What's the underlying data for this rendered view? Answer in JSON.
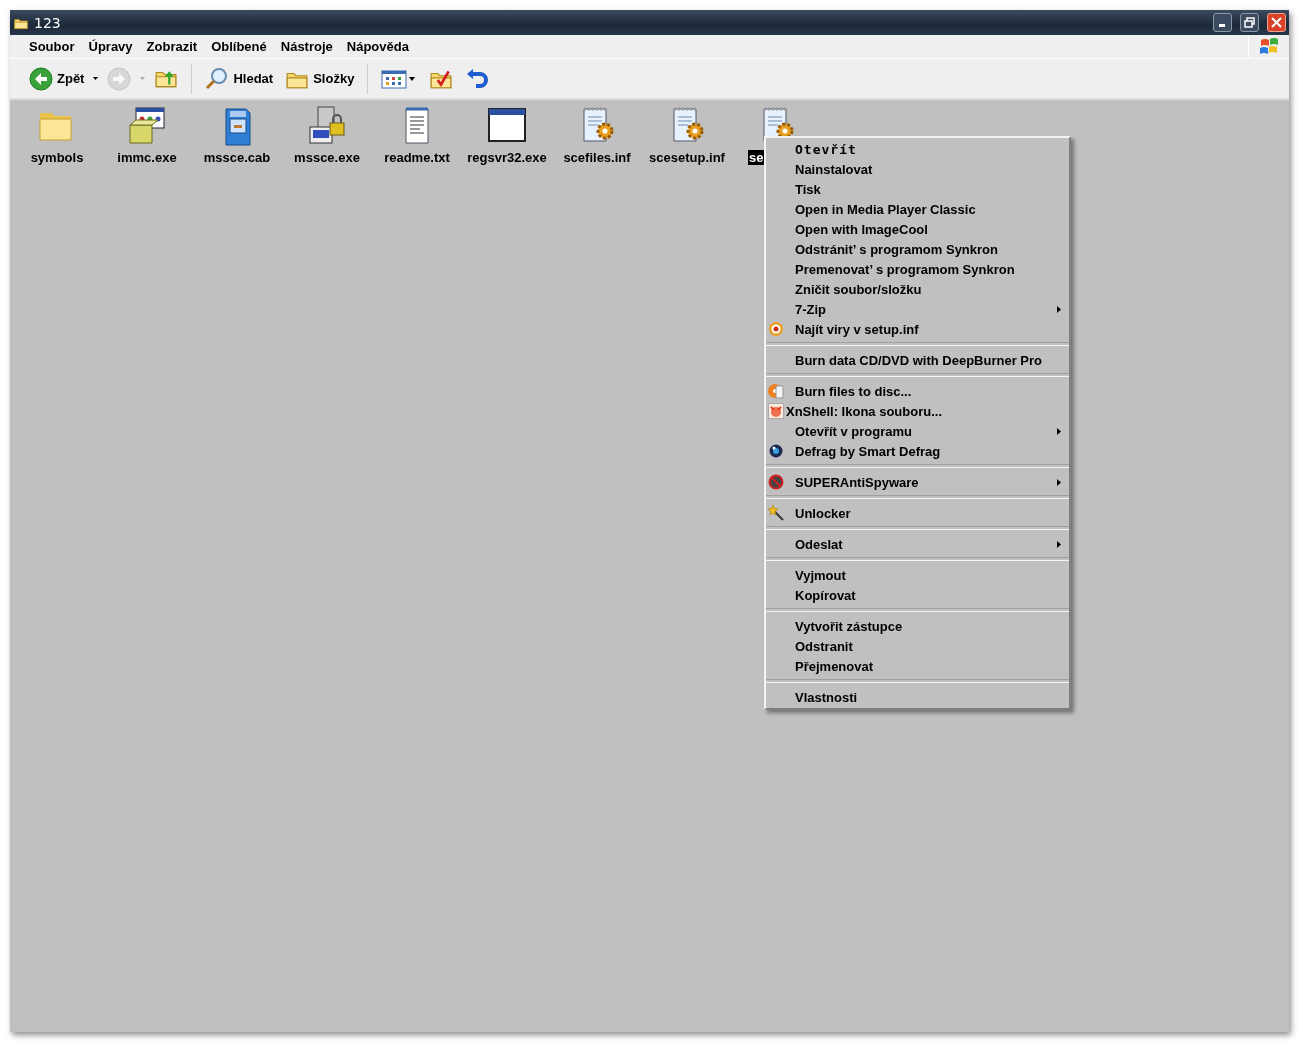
{
  "window": {
    "title": "123"
  },
  "menu_bar": [
    {
      "label": "Soubor"
    },
    {
      "label": "Úpravy"
    },
    {
      "label": "Zobrazit"
    },
    {
      "label": "Oblíbené"
    },
    {
      "label": "Nástroje"
    },
    {
      "label": "Nápověda"
    }
  ],
  "toolbar": [
    {
      "kind": "back",
      "label": "Zpět",
      "disabled": false
    },
    {
      "kind": "forward",
      "disabled": true
    },
    {
      "kind": "up",
      "disabled": false
    },
    {
      "kind": "search",
      "label": "Hledat",
      "disabled": false
    },
    {
      "kind": "folders",
      "label": "Složky",
      "disabled": false
    },
    {
      "kind": "views",
      "disabled": false
    },
    {
      "kind": "folder-check",
      "disabled": false
    },
    {
      "kind": "undo",
      "disabled": false
    }
  ],
  "files": [
    {
      "name": "symbols",
      "kind": "folder",
      "selected": false
    },
    {
      "name": "immc.exe",
      "kind": "installer",
      "selected": false
    },
    {
      "name": "mssce.cab",
      "kind": "cabinet",
      "selected": false
    },
    {
      "name": "mssce.exe",
      "kind": "server",
      "selected": false
    },
    {
      "name": "readme.txt",
      "kind": "text",
      "selected": false
    },
    {
      "name": "regsvr32.exe",
      "kind": "app",
      "selected": false
    },
    {
      "name": "scefiles.inf",
      "kind": "settings",
      "selected": false
    },
    {
      "name": "scesetup.inf",
      "kind": "settings",
      "selected": false
    },
    {
      "name": "se",
      "kind": "settings",
      "selected": true
    }
  ],
  "context_menu": [
    {
      "kind": "item",
      "label": "Otevřít",
      "default": true,
      "submenu": false
    },
    {
      "kind": "item",
      "label": "Nainstalovat",
      "default": false,
      "submenu": false
    },
    {
      "kind": "item",
      "label": "Tisk",
      "default": false,
      "submenu": false
    },
    {
      "kind": "item",
      "label": "Open in Media Player Classic",
      "default": false,
      "submenu": false
    },
    {
      "kind": "item",
      "label": "Open with ImageCool",
      "default": false,
      "submenu": false
    },
    {
      "kind": "item",
      "label": "Odstránit’ s programom Synkron",
      "default": false,
      "submenu": false
    },
    {
      "kind": "item",
      "label": "Premenovat’ s programom Synkron",
      "default": false,
      "submenu": false
    },
    {
      "kind": "item",
      "label": "Zničit soubor/složku",
      "default": false,
      "submenu": false
    },
    {
      "kind": "item",
      "label": "7-Zip",
      "default": false,
      "submenu": true
    },
    {
      "kind": "item",
      "label": "Najít viry v setup.inf",
      "default": false,
      "submenu": false
    },
    {
      "kind": "separator"
    },
    {
      "kind": "item",
      "label": "Burn data CD/DVD with DeepBurner Pro",
      "default": false,
      "submenu": false
    },
    {
      "kind": "separator"
    },
    {
      "kind": "item",
      "label": "Burn files to disc...",
      "default": false,
      "submenu": false
    },
    {
      "kind": "item",
      "label": "XnShell: Ikona souboru...",
      "default": false,
      "submenu": false
    },
    {
      "kind": "item",
      "label": "Otevřít v programu",
      "default": false,
      "submenu": true
    },
    {
      "kind": "item",
      "label": "Defrag by Smart Defrag",
      "default": false,
      "submenu": false
    },
    {
      "kind": "separator"
    },
    {
      "kind": "item",
      "label": "SUPERAntiSpyware",
      "default": false,
      "submenu": true
    },
    {
      "kind": "separator"
    },
    {
      "kind": "item",
      "label": "Unlocker",
      "default": false,
      "submenu": false
    },
    {
      "kind": "separator"
    },
    {
      "kind": "item",
      "label": "Odeslat",
      "default": false,
      "submenu": true
    },
    {
      "kind": "separator"
    },
    {
      "kind": "item",
      "label": "Vyjmout",
      "default": false,
      "submenu": false
    },
    {
      "kind": "item",
      "label": "Kopírovat",
      "default": false,
      "submenu": false
    },
    {
      "kind": "separator"
    },
    {
      "kind": "item",
      "label": "Vytvořit zástupce",
      "default": false,
      "submenu": false
    },
    {
      "kind": "item",
      "label": "Odstranit",
      "default": false,
      "submenu": false
    },
    {
      "kind": "item",
      "label": "Přejmenovat",
      "default": false,
      "submenu": false
    },
    {
      "kind": "separator"
    },
    {
      "kind": "item",
      "label": "Vlastnosti",
      "default": false,
      "submenu": false
    }
  ]
}
